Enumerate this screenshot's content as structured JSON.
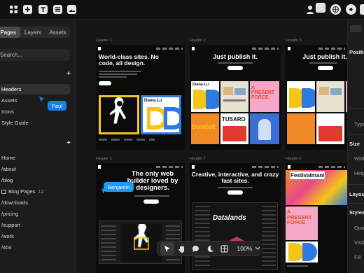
{
  "left_panel": {
    "tabs": [
      "Pages",
      "Layers",
      "Assets"
    ],
    "search_placeholder": "Search...",
    "sections_top": [
      {
        "label": "Headers"
      },
      {
        "label": "Assets"
      },
      {
        "label": "Icons"
      },
      {
        "label": "Style Guide"
      }
    ],
    "pages": [
      {
        "label": "Home"
      },
      {
        "label": "/about"
      },
      {
        "label": "/blog"
      },
      {
        "label": "Blog Pages",
        "count": "12"
      },
      {
        "label": "/downloads"
      },
      {
        "label": "/pricing"
      },
      {
        "label": "/support"
      },
      {
        "label": "/work"
      },
      {
        "label": "/404"
      }
    ]
  },
  "cursors": [
    {
      "name": "Paul",
      "color": "#1c7cf0"
    },
    {
      "name": "Benjamin",
      "color": "#1c9cf0"
    }
  ],
  "canvas": {
    "frames": [
      {
        "label": "Header 1",
        "headline": "World-class sites. No code, all design."
      },
      {
        "label": "Header 2",
        "headline": "Just publish it."
      },
      {
        "label": "Header 3",
        "headline": "Just publish it."
      },
      {
        "label": "Header 5",
        "headline": "The only web builder loved by designers."
      },
      {
        "label": "Header 7",
        "headline": "Creative, interactive, and crazy fast sites."
      },
      {
        "label": "Header 8",
        "headline": ""
      }
    ],
    "card_texts": {
      "diana": "Diana.Lu",
      "force": "A PRESENT FORCE",
      "tusaro": "TUSARO",
      "bonded": "Bonded",
      "datalands": "Datalands",
      "festival": "Festivalmani"
    }
  },
  "toolbar": {
    "zoom": "100%"
  },
  "right_panel": {
    "sections": [
      "Position",
      "Type",
      "Size",
      "Width",
      "Height",
      "Layout",
      "Styles",
      "Opacity",
      "Visible",
      "Fill"
    ]
  },
  "colors": {
    "accent": "#1c7cf0",
    "yellow": "#f5c518",
    "blue": "#2d7be0",
    "orange": "#f08a24"
  }
}
